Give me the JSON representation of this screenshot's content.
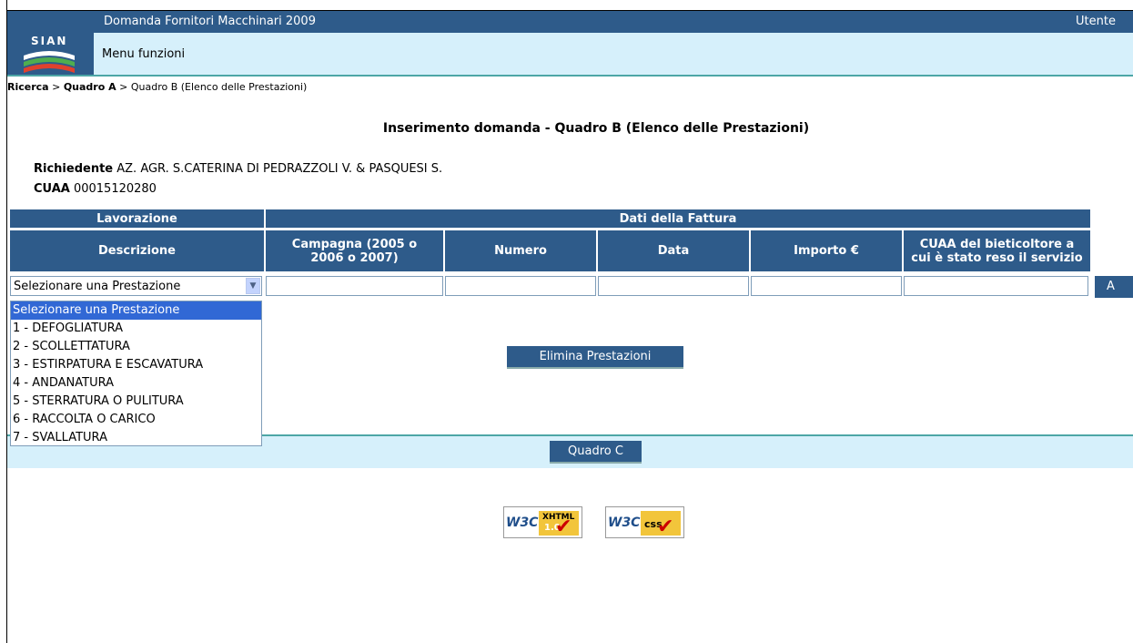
{
  "app": {
    "title": "Domanda Fornitori Macchinari 2009",
    "user_label": "Utente",
    "logo_text": "SIAN",
    "menu_label": "Menu funzioni"
  },
  "breadcrumb": {
    "item1": "Ricerca",
    "sep": " > ",
    "item2": "Quadro A",
    "item3": "Quadro B (Elenco delle Prestazioni)"
  },
  "page": {
    "heading": "Inserimento domanda - Quadro B (Elenco delle Prestazioni)",
    "richiedente_label": "Richiedente",
    "richiedente_value": "AZ. AGR. S.CATERINA DI PEDRAZZOLI V. & PASQUESI S.",
    "cuaa_label": "CUAA",
    "cuaa_value": "00015120280"
  },
  "table": {
    "group_lavorazione": "Lavorazione",
    "group_fattura": "Dati della Fattura",
    "col_descrizione": "Descrizione",
    "col_campagna_1": "Campagna (2005 o",
    "col_campagna_2": "2006 o 2007)",
    "col_numero": "Numero",
    "col_data": "Data",
    "col_importo": "Importo €",
    "col_cuaa_1": "CUAA del bieticoltore a",
    "col_cuaa_2": "cui è stato reso il servizio"
  },
  "form": {
    "select_value": "Selezionare una Prestazione",
    "add_button_label": "A",
    "options": [
      "Selezionare una Prestazione",
      "1 - DEFOGLIATURA",
      "2 - SCOLLETTATURA",
      "3 - ESTIRPATURA E ESCAVATURA",
      "4 - ANDANATURA",
      "5 - STERRATURA O PULITURA",
      "6 - RACCOLTA O CARICO",
      "7 - SVALLATURA"
    ]
  },
  "actions": {
    "elimina_label": "Elimina Prestazioni",
    "quadro_c_label": "Quadro C"
  },
  "badges": {
    "w3c_text": "W3C",
    "xhtml_top": "XHTML",
    "xhtml_bottom": "1.0",
    "css_text": "css"
  },
  "colors": {
    "header_blue": "#2e5b8a",
    "light_band": "#d6f0fb",
    "selected_option": "#3168d5"
  }
}
